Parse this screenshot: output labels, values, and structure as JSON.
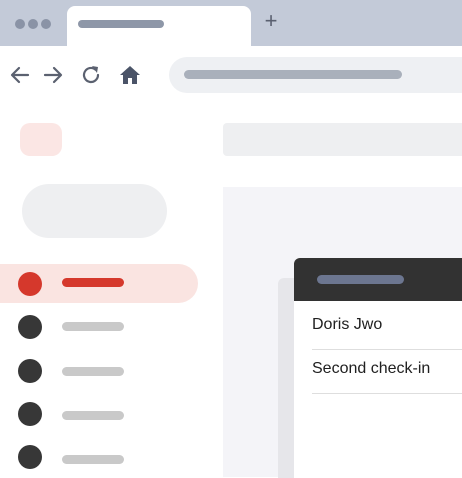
{
  "browser": {
    "tabstrip_color": "#c3cad8",
    "window_controls": [
      "window-dot",
      "window-dot",
      "window-dot"
    ],
    "new_tab_label": "+",
    "nav_icons": [
      "back-arrow-icon",
      "forward-arrow-icon",
      "refresh-icon",
      "home-icon"
    ]
  },
  "app": {
    "accent_color": "#d5382c",
    "sidebar": {
      "items": [
        {
          "state": "active"
        },
        {
          "state": "inactive"
        },
        {
          "state": "inactive"
        },
        {
          "state": "inactive"
        },
        {
          "state": "inactive"
        }
      ]
    },
    "card": {
      "header_color": "#323232",
      "rows": [
        {
          "text": "Doris Jwo"
        },
        {
          "text": "Second check-in"
        }
      ]
    }
  }
}
